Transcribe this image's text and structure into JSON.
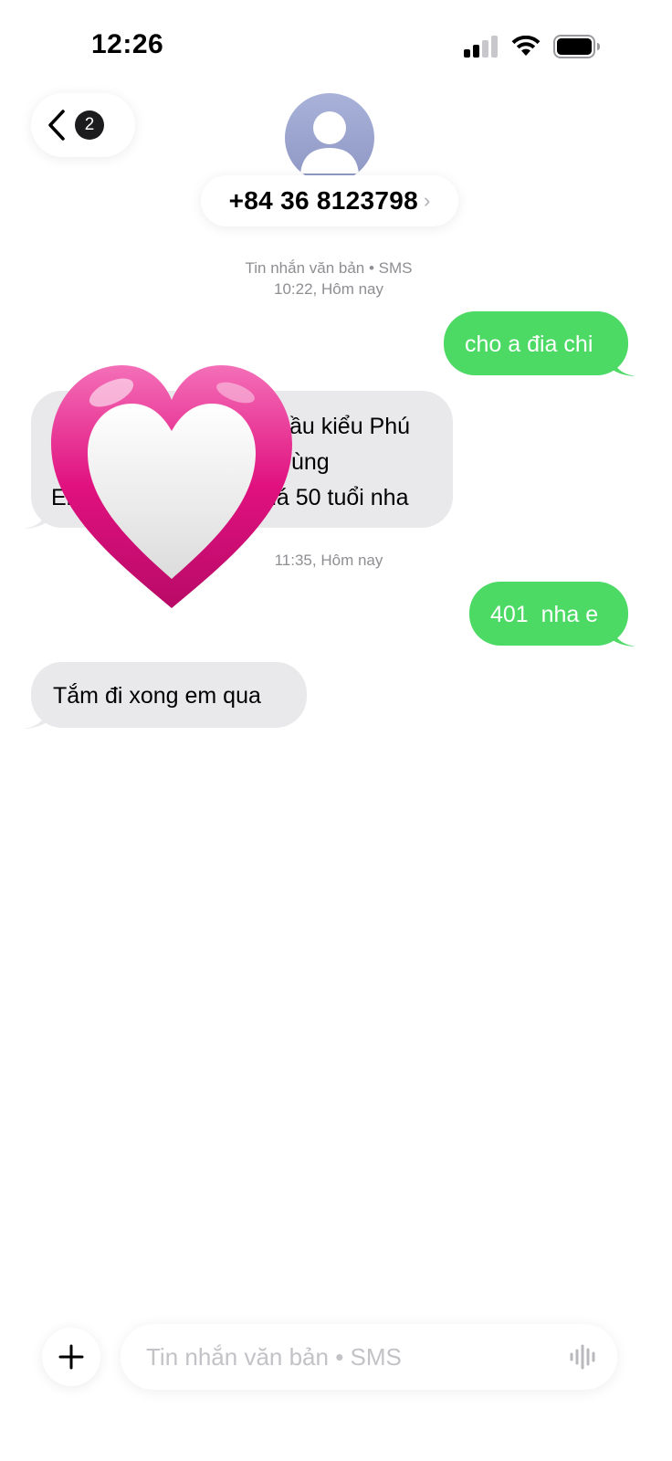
{
  "status_bar": {
    "time": "12:26",
    "icons": [
      "signal-icon",
      "wifi-icon",
      "battery-icon"
    ]
  },
  "header": {
    "back_badge": "2",
    "contact_name": "+84 36 8123798",
    "chevron": "›"
  },
  "thread_meta": [
    {
      "line1": "Tin nhắn văn bản • SMS",
      "line2": "10:22, Hôm nay"
    },
    {
      "line1": "11:35, Hôm nay"
    }
  ],
  "messages": [
    {
      "direction": "out",
      "text": "cho a đia chi"
    },
    {
      "direction": "in",
      "lines": [
        "ầu kiểu Phú",
        "ùng",
        "uá 50 tuổi nha"
      ],
      "partial_prefixes": [
        "",
        "I",
        "Er"
      ]
    },
    {
      "direction": "out",
      "text": "401  nha e"
    },
    {
      "direction": "in",
      "text": "Tắm đi xong em qua"
    }
  ],
  "overlay": {
    "icon": "heart-emoji-icon"
  },
  "composer": {
    "placeholder": "Tin nhắn văn bản • SMS",
    "plus_icon": "plus-icon",
    "mic_icon": "waveform-icon"
  },
  "colors": {
    "outgoing": "#4cd964",
    "incoming": "#e9e9eb",
    "meta": "#8e8e93",
    "heart": "#e0117f"
  }
}
